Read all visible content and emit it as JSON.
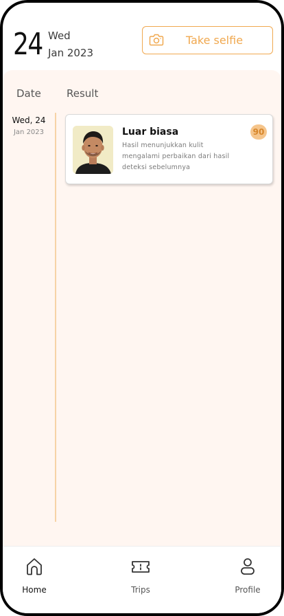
{
  "header": {
    "day": "24",
    "weekday": "Wed",
    "month_year": "Jan 2023",
    "selfie_button_label": "Take selfie"
  },
  "table": {
    "col_date": "Date",
    "col_result": "Result"
  },
  "entries": [
    {
      "date_line1": "Wed, 24",
      "date_line2": "Jan 2023",
      "title": "Luar biasa",
      "description": "Hasil menunjukkan  kulit mengalami perbaikan dari hasil deteksi sebelumnya",
      "score": "90"
    }
  ],
  "nav": {
    "items": [
      {
        "label": "Home",
        "icon": "home-icon",
        "active": true
      },
      {
        "label": "Trips",
        "icon": "ticket-icon",
        "active": false
      },
      {
        "label": "Profile",
        "icon": "user-icon",
        "active": false
      }
    ]
  },
  "colors": {
    "accent": "#f0a84f",
    "background_panel": "#fff6f1",
    "timeline": "#f6d3a6",
    "score_badge": "#f5c58c"
  }
}
